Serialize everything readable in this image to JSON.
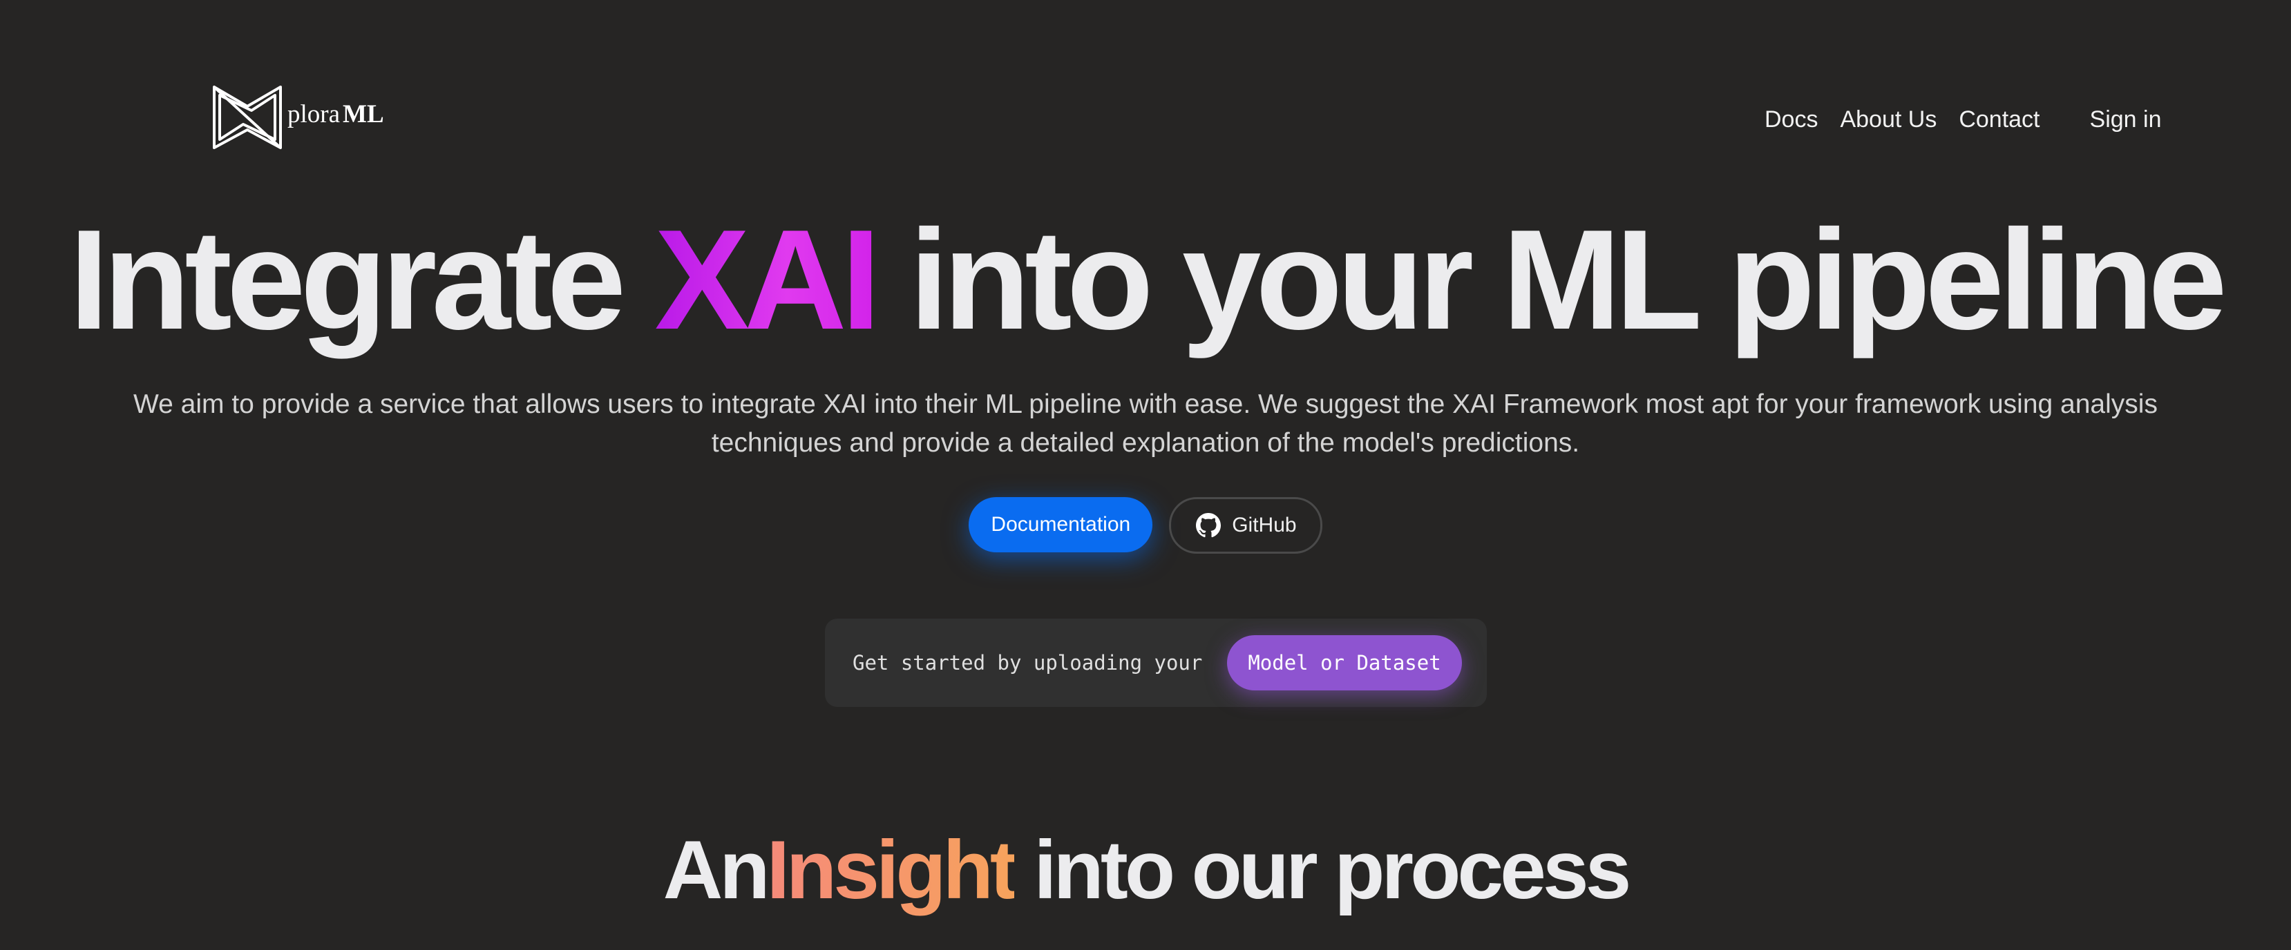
{
  "header": {
    "logo_word": "plora",
    "logo_suffix": "ML",
    "nav": {
      "docs": "Docs",
      "about": "About Us",
      "contact": "Contact",
      "sign_in": "Sign in"
    }
  },
  "hero": {
    "title_prefix": "Integrate ",
    "title_highlight": "XAI",
    "title_suffix": " into your ML pipeline",
    "description": "We aim to provide a service that allows users to integrate XAI into their ML pipeline with ease. We suggest the XAI Framework most apt for your framework using analysis techniques and provide a detailed explanation of the model's predictions.",
    "documentation_button": "Documentation",
    "github_button": "GitHub"
  },
  "upload": {
    "prompt": "Get started by uploading your",
    "button": "Model or Dataset"
  },
  "process": {
    "title_prefix": "An",
    "title_highlight": "Insight",
    "title_suffix": " into our process"
  },
  "colors": {
    "background": "#262524",
    "xai_gradient": "#c426eb",
    "primary_button": "#0a6cf0",
    "upload_button": "#8e54d0",
    "insight_gradient": "#f7956a"
  },
  "icons": {
    "logo": "xplora-logo-icon",
    "github": "github-icon"
  }
}
